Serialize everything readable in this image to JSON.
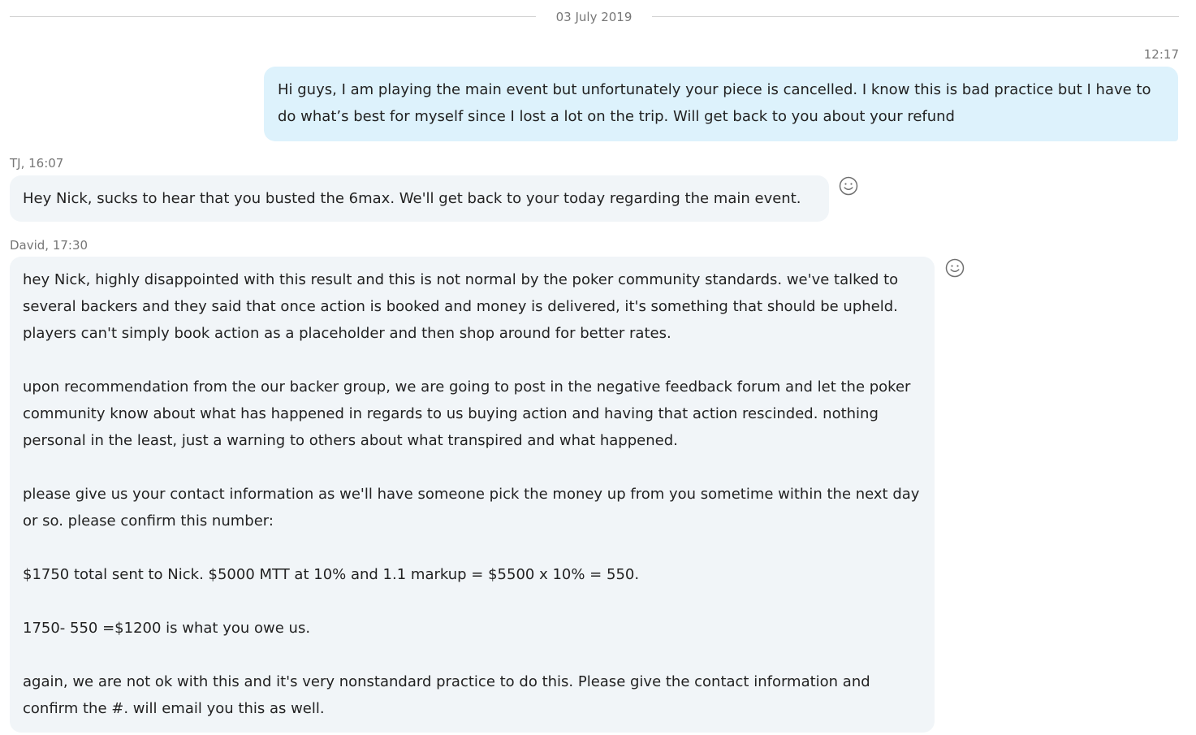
{
  "conversation": {
    "date_divider": "03 July 2019",
    "messages": [
      {
        "direction": "outgoing",
        "timestamp": "12:17",
        "text": "Hi guys, I am playing the main event but unfortunately your piece is cancelled. I know this is bad practice but I have to do what’s best for myself since I lost a lot on the trip. Will get back to you about your refund"
      },
      {
        "direction": "incoming",
        "sender_meta": "TJ, 16:07",
        "text": "Hey Nick, sucks to hear that you busted the 6max. We'll get back to your today regarding the main event.",
        "reaction_icon": "smiley-icon"
      },
      {
        "direction": "incoming",
        "sender_meta": "David, 17:30",
        "text": "hey Nick, highly disappointed with this result and this is not normal by the poker community standards. we've talked to several backers and they said that once action is booked and money is delivered, it's something that should be upheld. players can't simply book action as a placeholder and then shop around for better rates.\n\nupon recommendation from the our backer group, we are going to post in the negative feedback forum and let the poker community know about what has happened in regards to us buying action and having that action rescinded. nothing personal in the least, just a warning to others about what transpired and what happened.\n\nplease give us your contact information as we'll have someone pick the money up from you sometime within the next day or so. please confirm this number:\n\n$1750 total sent to Nick. $5000 MTT at 10% and 1.1 markup = $5500 x 10% = 550.\n\n1750- 550 =$1200 is what you owe us.\n\nagain, we are not ok with this and it's very nonstandard practice to do this. Please give the contact information and confirm the #. will email you this as well.",
        "reaction_icon": "smiley-icon"
      }
    ]
  },
  "colors": {
    "outgoing_bubble": "#ddf2fc",
    "incoming_bubble": "#f1f5f8",
    "meta_text": "#777777"
  }
}
